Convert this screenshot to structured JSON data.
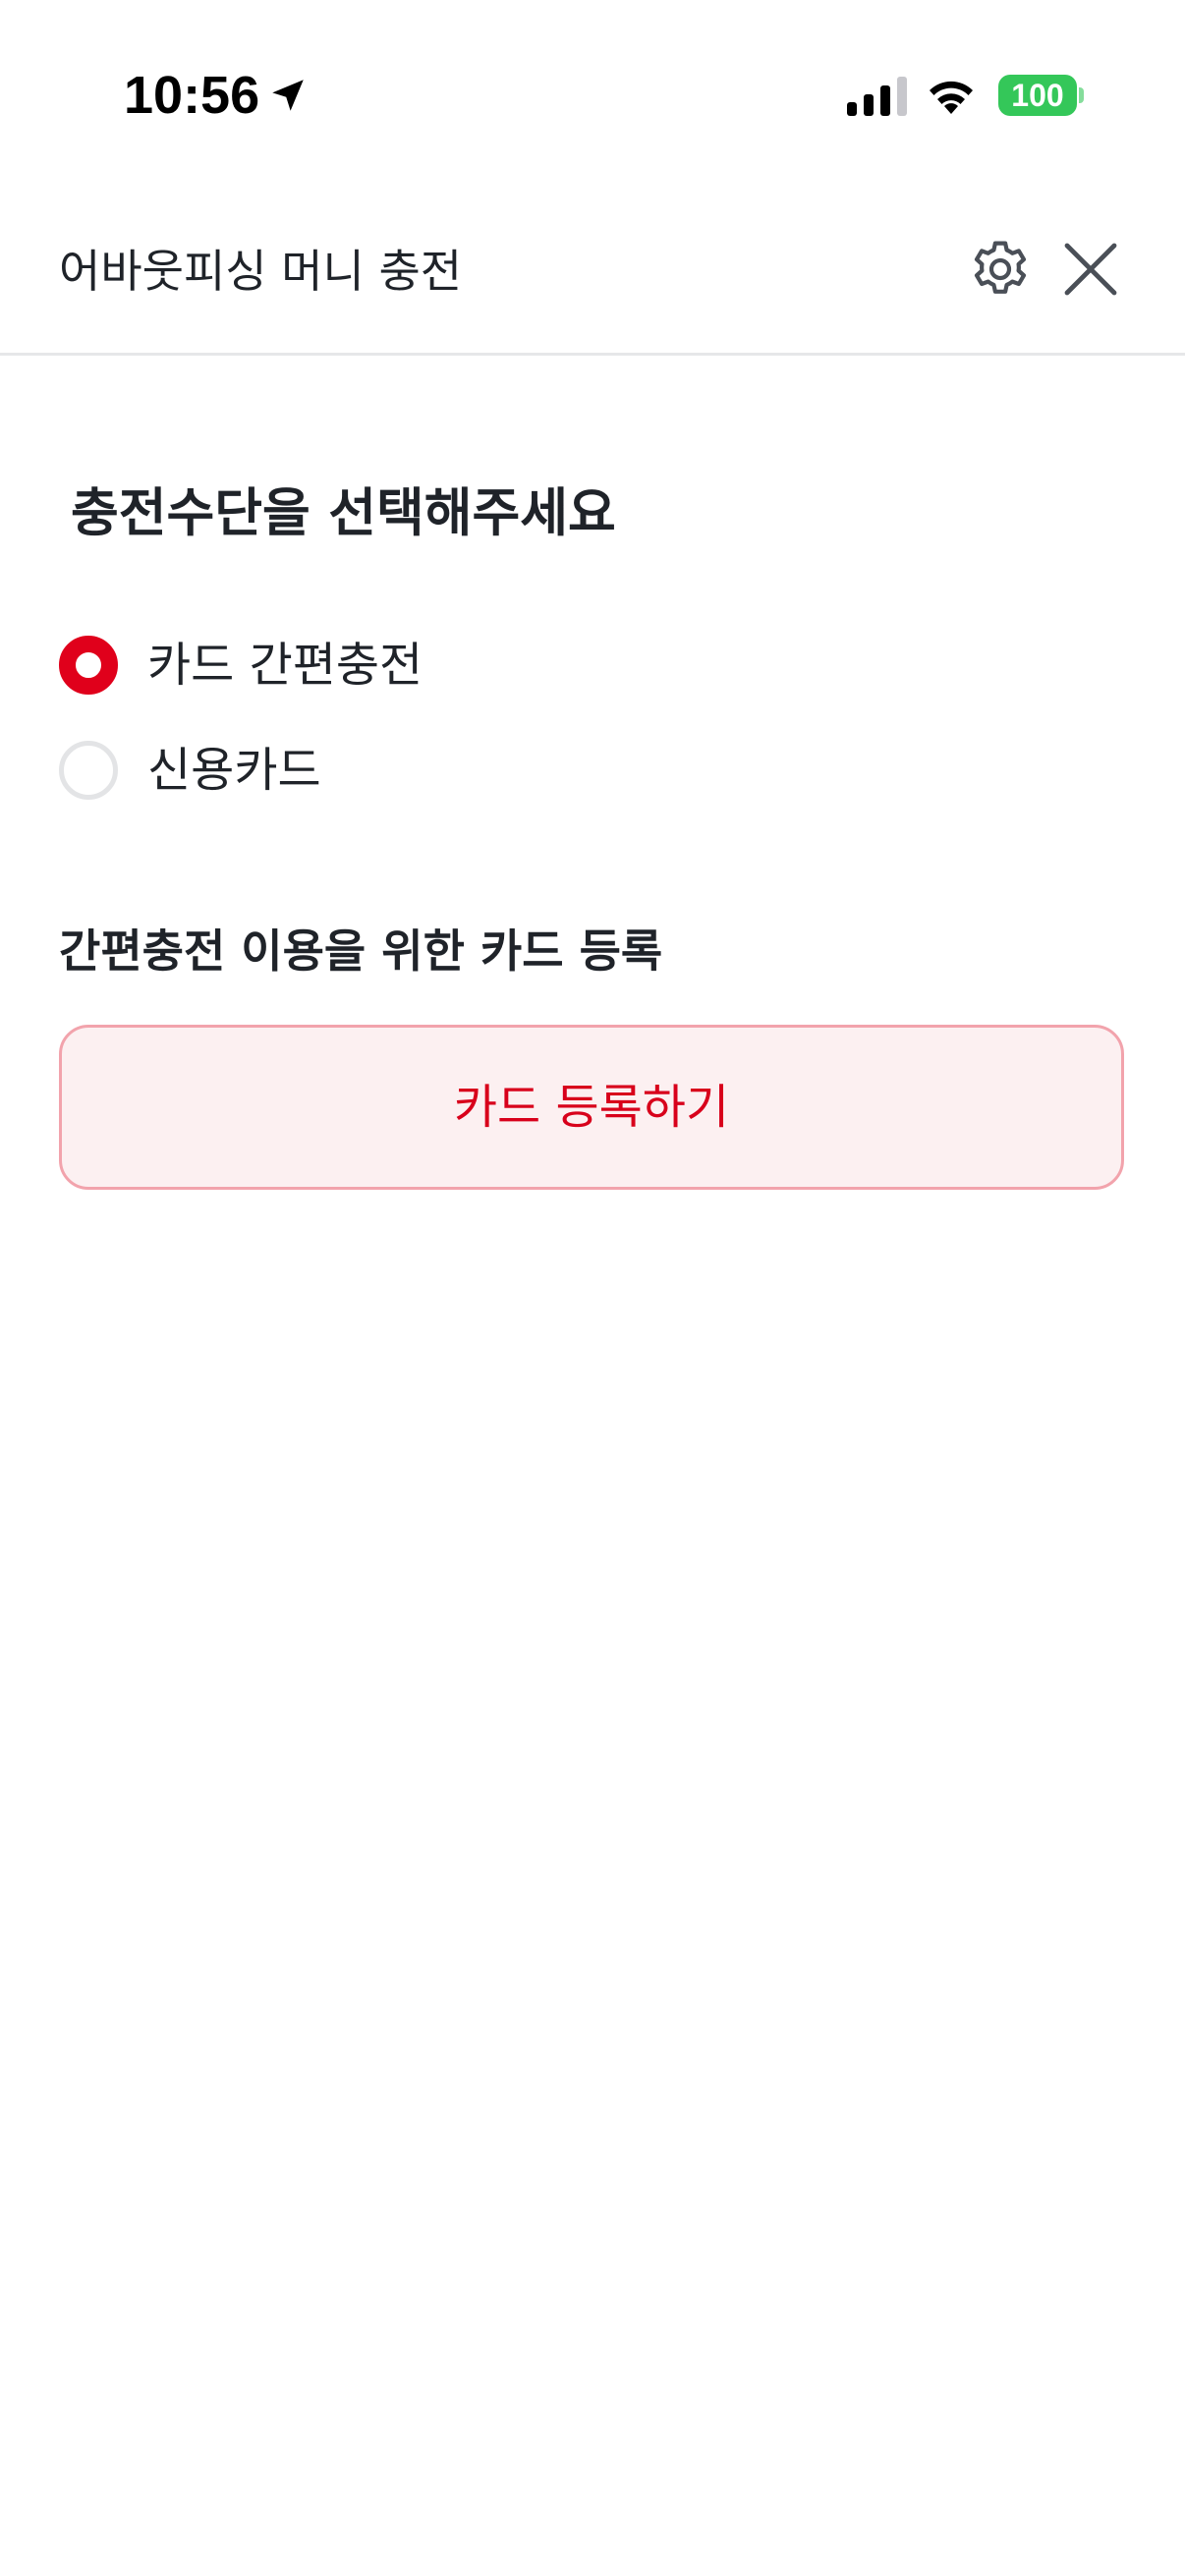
{
  "status_bar": {
    "time": "10:56",
    "battery_level": "100",
    "battery_color": "#34c759",
    "icons": [
      "location-arrow-icon",
      "cellular-signal-icon",
      "wifi-icon",
      "battery-icon"
    ]
  },
  "header": {
    "title": "어바웃피싱 머니 충전",
    "icons": [
      "gear-icon",
      "close-icon"
    ]
  },
  "payment_method": {
    "title": "충전수단을 선택해주세요",
    "options": [
      {
        "label": "카드 간편충전",
        "selected": true
      },
      {
        "label": "신용카드",
        "selected": false
      }
    ]
  },
  "card_registration": {
    "title": "간편충전 이용을 위한 카드 등록",
    "button_label": "카드 등록하기"
  },
  "colors": {
    "accent": "#e0001b",
    "button_background": "#fcf0f1",
    "button_border": "#f2a3ac",
    "divider": "#e6e7e9"
  }
}
